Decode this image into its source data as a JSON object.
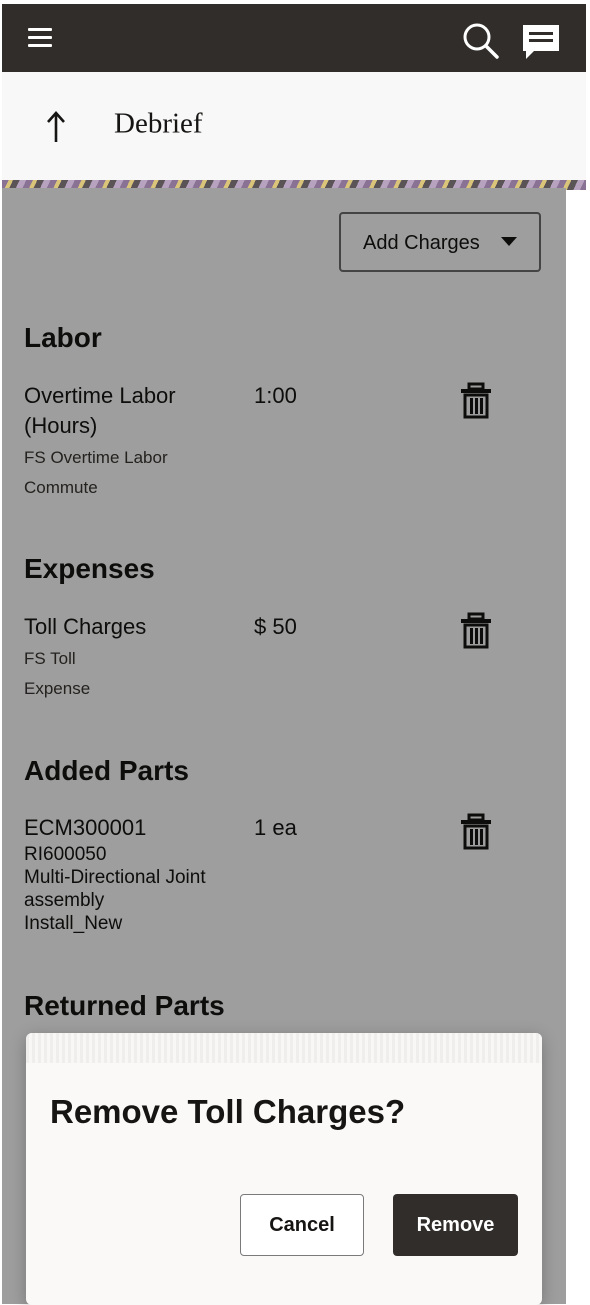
{
  "header": {
    "title": "Debrief",
    "icons": [
      "menu-icon",
      "search-icon",
      "chat-icon",
      "back-arrow-icon"
    ]
  },
  "toolbar": {
    "add_charges_label": "Add Charges"
  },
  "sections": {
    "labor": {
      "heading": "Labor",
      "item": {
        "name_line1": "Overtime Labor",
        "name_line2": "(Hours)",
        "qty": "1:00",
        "sub1": "FS Overtime Labor",
        "sub2": "Commute"
      }
    },
    "expenses": {
      "heading": "Expenses",
      "item": {
        "name": "Toll Charges",
        "qty": "$ 50",
        "sub1": "FS Toll",
        "sub2": "Expense"
      }
    },
    "added_parts": {
      "heading": "Added Parts",
      "item": {
        "name": "ECM300001",
        "qty": "1 ea",
        "line1": "RI600050",
        "line2": "Multi-Directional Joint",
        "line3": "assembly",
        "line4": "Install_New"
      }
    },
    "returned_parts": {
      "heading": "Returned Parts"
    }
  },
  "dialog": {
    "title": "Remove Toll Charges?",
    "cancel_label": "Cancel",
    "remove_label": "Remove"
  },
  "colors": {
    "header_bg": "#312d2a",
    "primary_button": "#312d2a",
    "scrim": "rgba(0,0,0,0.38)"
  }
}
